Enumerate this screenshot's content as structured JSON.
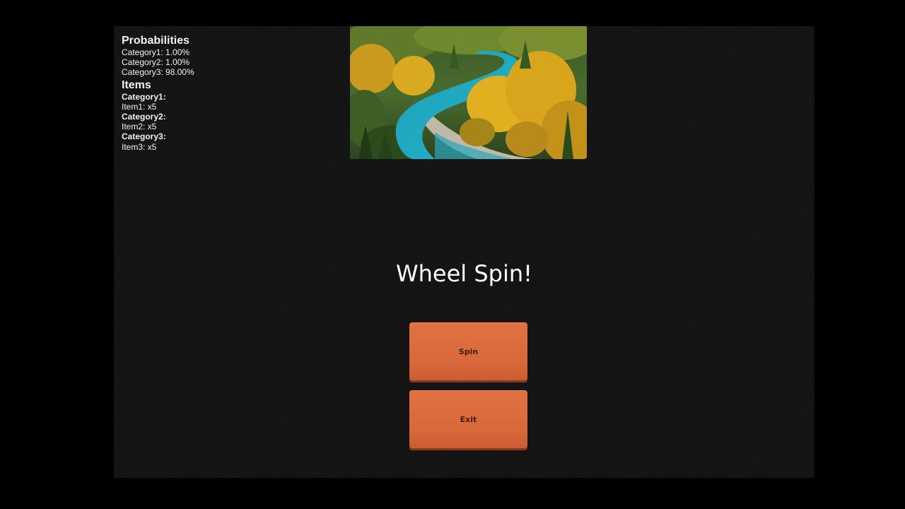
{
  "probabilities": {
    "heading": "Probabilities",
    "lines": [
      "Category1: 1.00%",
      "Category2: 1.00%",
      "Category3: 98.00%"
    ]
  },
  "items": {
    "heading": "Items",
    "groups": [
      {
        "category": "Category1:",
        "item": "Item1: x5"
      },
      {
        "category": "Category2:",
        "item": "Item2: x5"
      },
      {
        "category": "Category3:",
        "item": "Item3: x5"
      }
    ]
  },
  "banner": {
    "icon": "autumn-river-landscape-image"
  },
  "title": "Wheel Spin!",
  "buttons": {
    "spin_label": "Spin",
    "exit_label": "Exit"
  },
  "colors": {
    "background": "#000000",
    "stage": "#141414",
    "button": "#dc6b3c",
    "button_text": "#3a1f14",
    "text": "#ffffff"
  }
}
